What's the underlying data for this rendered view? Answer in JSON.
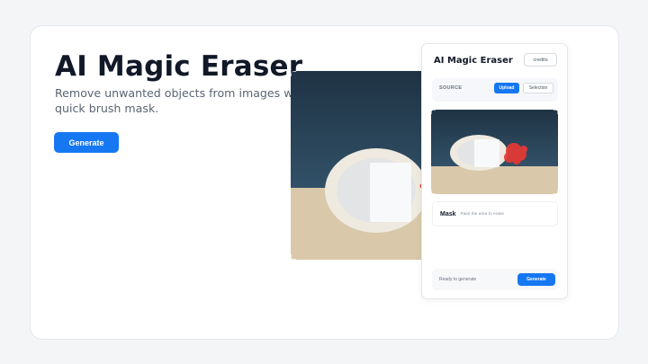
{
  "hero": {
    "title": "AI Magic Eraser",
    "subtitle": "Remove unwanted objects from images with a quick brush mask.",
    "generate_label": "Generate"
  },
  "panel": {
    "title": "AI Magic Eraser",
    "credits_label": "credits",
    "source": {
      "label": "SOURCE",
      "upload_label": "Upload",
      "selection_label": "Selection"
    },
    "mask": {
      "label": "Mask",
      "hint": "Paint the area to erase"
    },
    "footer": {
      "status": "Ready to generate",
      "generate_label": "Generate"
    }
  },
  "colors": {
    "accent": "#1677f2",
    "mask_red": "#e53935",
    "sky": "#2a4255",
    "table": "#d9c9aa"
  },
  "icons": {
    "mask_brush_stroke": "red-brush-mask"
  }
}
